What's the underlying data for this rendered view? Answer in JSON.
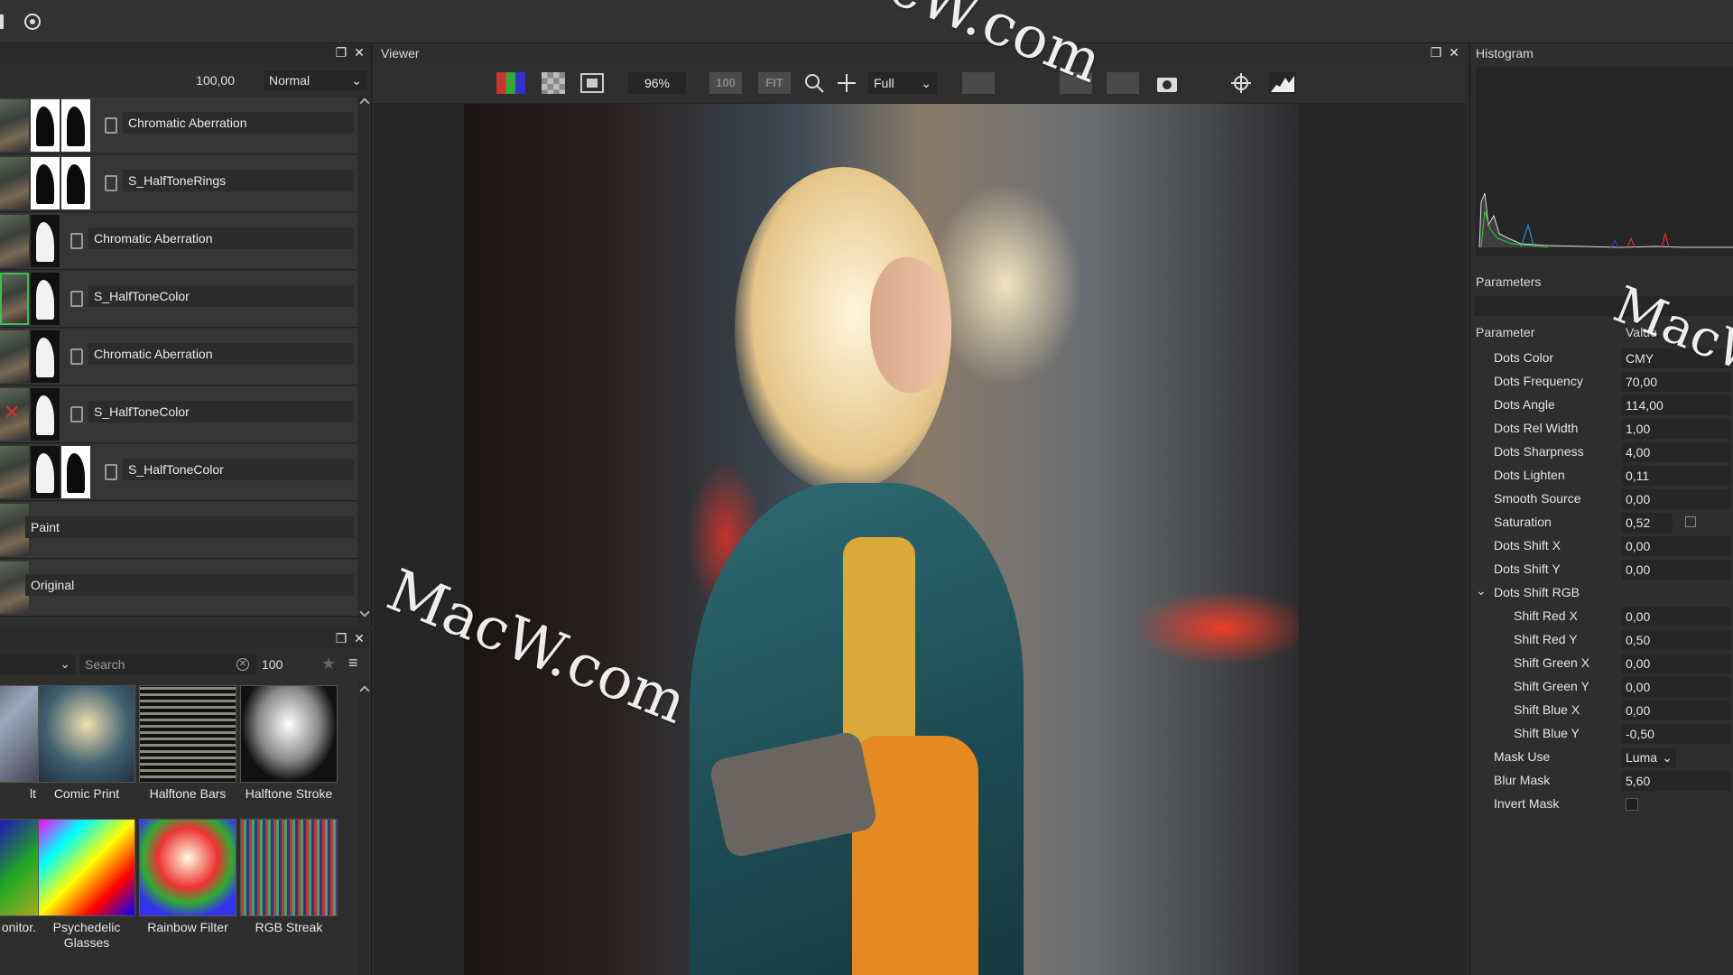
{
  "layers": {
    "opacity": "100,00",
    "blend_mode": "Normal",
    "items": [
      {
        "name": "Chromatic Aberration"
      },
      {
        "name": "S_HalfToneRings"
      },
      {
        "name": "Chromatic Aberration"
      },
      {
        "name": "S_HalfToneColor"
      },
      {
        "name": "Chromatic Aberration"
      },
      {
        "name": "S_HalfToneColor"
      },
      {
        "name": "S_HalfToneColor"
      },
      {
        "name": "Paint"
      },
      {
        "name": "Original"
      }
    ]
  },
  "presets": {
    "search_placeholder": "Search",
    "size": "100",
    "items": [
      {
        "label": "Comic Print"
      },
      {
        "label": "Halftone Bars"
      },
      {
        "label": "Halftone Stroke"
      },
      {
        "label": "Psychedelic Glasses"
      },
      {
        "label": "Rainbow Filter"
      },
      {
        "label": "RGB Streak"
      }
    ],
    "partial_labels": [
      "lt",
      "onitor."
    ]
  },
  "viewer": {
    "title": "Viewer",
    "zoom": "96%",
    "btn_100": "100",
    "btn_fit": "FIT",
    "resolution": "Full"
  },
  "watermark": "MacW.com",
  "histogram": {
    "title": "Histogram"
  },
  "parameters": {
    "title": "Parameters",
    "col_param": "Parameter",
    "col_value": "Value",
    "rows": [
      {
        "name": "Dots Color",
        "value": "CMY"
      },
      {
        "name": "Dots Frequency",
        "value": "70,00"
      },
      {
        "name": "Dots Angle",
        "value": "114,00"
      },
      {
        "name": "Dots Rel Width",
        "value": "1,00"
      },
      {
        "name": "Dots Sharpness",
        "value": "4,00"
      },
      {
        "name": "Dots Lighten",
        "value": "0,11"
      },
      {
        "name": "Smooth Source",
        "value": "0,00"
      },
      {
        "name": "Saturation",
        "value": "0,52"
      },
      {
        "name": "Dots Shift X",
        "value": "0,00"
      },
      {
        "name": "Dots Shift Y",
        "value": "0,00"
      }
    ],
    "group": "Dots Shift RGB",
    "group_rows": [
      {
        "name": "Shift Red X",
        "value": "0,00"
      },
      {
        "name": "Shift Red Y",
        "value": "0,50"
      },
      {
        "name": "Shift Green X",
        "value": "0,00"
      },
      {
        "name": "Shift Green Y",
        "value": "0,00"
      },
      {
        "name": "Shift Blue X",
        "value": "0,00"
      },
      {
        "name": "Shift Blue Y",
        "value": "-0,50"
      }
    ],
    "tail_rows": [
      {
        "name": "Mask Use",
        "value": "Luma"
      },
      {
        "name": "Blur Mask",
        "value": "5,60"
      },
      {
        "name": "Invert Mask",
        "value": ""
      }
    ]
  }
}
